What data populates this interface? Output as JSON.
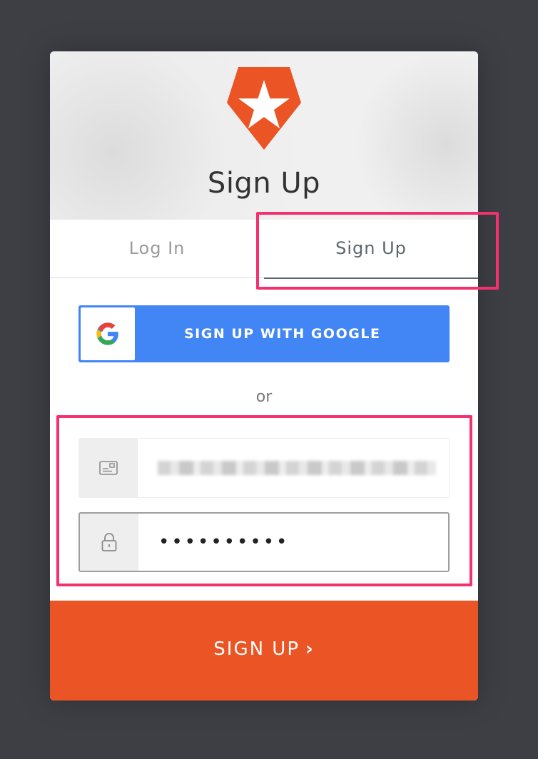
{
  "header": {
    "title": "Sign Up"
  },
  "tabs": [
    {
      "label": "Log In",
      "active": false
    },
    {
      "label": "Sign Up",
      "active": true
    }
  ],
  "social": {
    "google_label": "SIGN UP WITH GOOGLE"
  },
  "divider": {
    "text": "or"
  },
  "fields": {
    "email": {
      "icon": "email-card-icon",
      "value": ""
    },
    "password": {
      "icon": "lock-icon",
      "value": "••••••••••"
    }
  },
  "submit": {
    "label": "SIGN UP",
    "icon": "chevron-right-icon"
  },
  "colors": {
    "brand": "#eb5424",
    "google": "#4285f4",
    "highlight": "#f5306e",
    "background": "#3d3f45"
  }
}
